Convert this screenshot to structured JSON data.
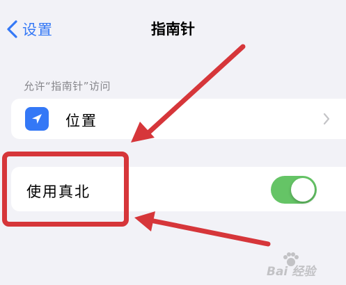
{
  "nav": {
    "back_label": "设置",
    "title": "指南针"
  },
  "section": {
    "header": "允许“指南针”访问"
  },
  "location_row": {
    "label": "位置",
    "icon": "location-arrow-icon"
  },
  "true_north_row": {
    "label": "使用真北",
    "toggle_on": true
  },
  "annotation": {
    "highlight_color": "#d6363a"
  },
  "watermark": {
    "text": "Bai 经验"
  },
  "colors": {
    "accent": "#3478f6",
    "toggle_on": "#65c466",
    "background": "#f2f2f7",
    "secondary_text": "#86868b"
  }
}
